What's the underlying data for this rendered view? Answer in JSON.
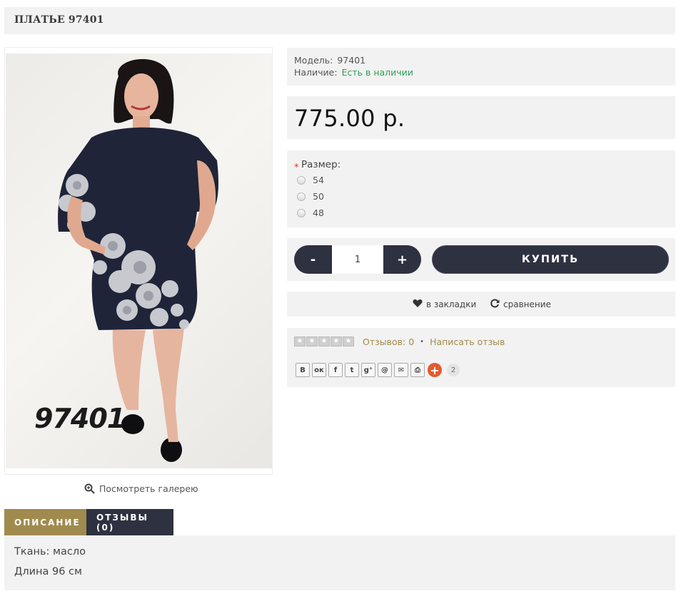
{
  "product": {
    "title": "ПЛАТЬЕ 97401",
    "image_label": "97401",
    "gallery_link": "Посмотреть галерею"
  },
  "info": {
    "model_label": "Модель:",
    "model_value": "97401",
    "stock_label": "Наличие:",
    "stock_value": "Есть в наличии",
    "stock_color": "#2f9e57"
  },
  "price": "775.00 р.",
  "size": {
    "label": "Размер:",
    "required_mark": "*",
    "options": [
      "54",
      "50",
      "48"
    ]
  },
  "buy": {
    "minus": "-",
    "plus": "+",
    "quantity": "1",
    "button": "КУПИТЬ"
  },
  "actions": {
    "wishlist": "в закладки",
    "compare": "сравнение"
  },
  "reviews": {
    "rating": 0,
    "count_text": "Отзывов: 0",
    "separator": "•",
    "write": "Написать отзыв"
  },
  "share": {
    "buttons": [
      "vk-icon",
      "odnoklassniki-icon",
      "facebook-icon",
      "twitter-icon",
      "google-plus-icon",
      "mail-ru-icon",
      "email-icon",
      "print-icon"
    ],
    "glyphs": [
      "В",
      "ок",
      "f",
      "t",
      "g⁺",
      "@",
      "✉",
      "⎙"
    ],
    "counter": "2"
  },
  "tabs": {
    "description": "ОПИСАНИЕ",
    "reviews": "ОТЗЫВЫ (0)"
  },
  "description": {
    "line1": "Ткань: масло",
    "line2": "Длина 96 см"
  },
  "colors": {
    "dark": "#2e3140",
    "gold": "#a18a4d",
    "panel": "#f2f2f2",
    "accent_red": "#e25b2d"
  }
}
